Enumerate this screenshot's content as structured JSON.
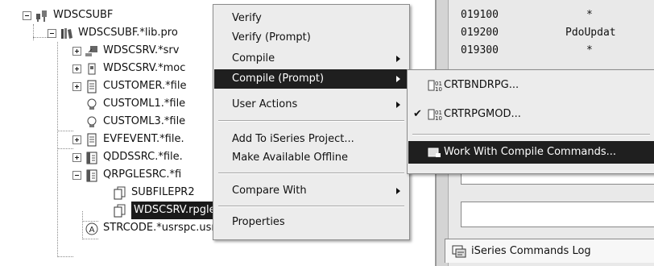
{
  "tree": {
    "items": [
      {
        "label": "WDSCSUBF",
        "twisty": "minus",
        "icon": "connection-icon",
        "selected": false
      },
      {
        "label": "WDSCSUBF.*lib.pro",
        "twisty": "minus",
        "icon": "library-icon",
        "selected": false
      },
      {
        "label": "WDSCSRV.*srv",
        "twisty": "plus",
        "icon": "service-program-icon",
        "selected": false
      },
      {
        "label": "WDSCSRV.*moc",
        "twisty": "plus",
        "icon": "module-icon",
        "selected": false
      },
      {
        "label": "CUSTOMER.*file",
        "twisty": "plus",
        "icon": "file-icon",
        "selected": false
      },
      {
        "label": "CUSTOML1.*file",
        "twisty": "none",
        "icon": "logical-file-icon",
        "selected": false
      },
      {
        "label": "CUSTOML3.*file",
        "twisty": "none",
        "icon": "logical-file-icon",
        "selected": false
      },
      {
        "label": "EVFEVENT.*file.",
        "twisty": "plus",
        "icon": "file-icon",
        "selected": false
      },
      {
        "label": "QDDSSRC.*file.",
        "twisty": "plus",
        "icon": "source-file-icon",
        "selected": false
      },
      {
        "label": "QRPGLESRC.*fi",
        "twisty": "minus",
        "icon": "source-file-icon",
        "selected": false
      },
      {
        "label": "SUBFILEPR2",
        "twisty": "none",
        "icon": "member-icon",
        "selected": false
      },
      {
        "label": "WDSCSRV.rpgle",
        "twisty": "none",
        "icon": "member-icon",
        "selected": true
      },
      {
        "label": "STRCODE.*usrspc.usrdft",
        "twisty": "none",
        "icon": "user-space-icon",
        "selected": false
      }
    ]
  },
  "editor": {
    "lines": [
      {
        "seq": "019100",
        "text": "*"
      },
      {
        "seq": "019200",
        "text": "PdoUpdat"
      },
      {
        "seq": "019300",
        "text": "*"
      }
    ],
    "commands_log_label": "iSeries Commands Log",
    "commands_log_icon": "commands-log-icon"
  },
  "context_menu": {
    "items": [
      {
        "label": "Verify",
        "submenu": false,
        "active": false
      },
      {
        "label": "Verify (Prompt)",
        "submenu": false,
        "active": false
      },
      {
        "label": "Compile",
        "submenu": true,
        "active": false
      },
      {
        "label": "Compile (Prompt)",
        "submenu": true,
        "active": true
      },
      {
        "label": "User Actions",
        "submenu": true,
        "active": false
      },
      {
        "label": "Add To iSeries Project...",
        "submenu": false,
        "active": false
      },
      {
        "label": "Make Available Offline",
        "submenu": false,
        "active": false
      },
      {
        "label": "Compare With",
        "submenu": true,
        "active": false
      },
      {
        "label": "Properties",
        "submenu": false,
        "active": false
      }
    ]
  },
  "submenu": {
    "items": [
      {
        "label": "CRTBNDRPG...",
        "icon": "compile-command-icon",
        "checked": false,
        "active": false
      },
      {
        "label": "CRTRPGMOD...",
        "icon": "compile-command-icon",
        "checked": true,
        "active": false
      },
      {
        "label": "Work With Compile Commands...",
        "icon": "work-with-commands-icon",
        "checked": false,
        "active": true
      }
    ]
  },
  "colors": {
    "selection": "#1f1f1f",
    "menu_bg": "#ececec",
    "tree_bg": "#ffffff",
    "editor_bg": "#e9e9e9"
  }
}
